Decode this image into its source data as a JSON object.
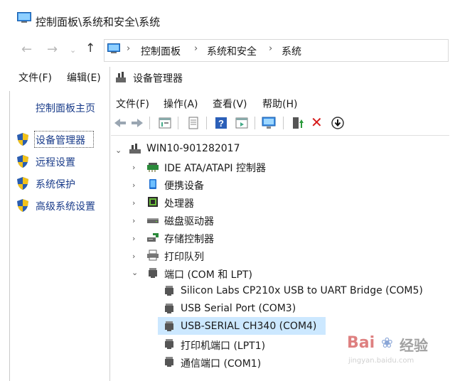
{
  "outer_window": {
    "title": "控制面板\\系统和安全\\系统",
    "breadcrumbs": [
      "控制面板",
      "系统和安全",
      "系统"
    ],
    "menu": [
      "文件(F)",
      "编辑(E)"
    ]
  },
  "left_pane": {
    "home": "控制面板主页",
    "items": [
      {
        "label": "设备管理器",
        "icon": "shield-icon"
      },
      {
        "label": "远程设置",
        "icon": "shield-icon"
      },
      {
        "label": "系统保护",
        "icon": "shield-icon"
      },
      {
        "label": "高级系统设置",
        "icon": "shield-icon"
      }
    ]
  },
  "device_manager": {
    "title": "设备管理器",
    "menu": [
      "文件(F)",
      "操作(A)",
      "查看(V)",
      "帮助(H)"
    ],
    "toolbar": [
      "back-icon",
      "forward-icon",
      "properties-icon",
      "print-icon",
      "help-icon",
      "view-icon",
      "monitor-icon",
      "update-driver-icon",
      "uninstall-icon",
      "download-icon"
    ],
    "root": "WIN10-901282017",
    "categories": [
      {
        "label": "IDE ATA/ATAPI 控制器",
        "expanded": false,
        "icon": "ide-controller-icon"
      },
      {
        "label": "便携设备",
        "expanded": false,
        "icon": "portable-device-icon"
      },
      {
        "label": "处理器",
        "expanded": false,
        "icon": "processor-icon"
      },
      {
        "label": "磁盘驱动器",
        "expanded": false,
        "icon": "disk-drive-icon"
      },
      {
        "label": "存储控制器",
        "expanded": false,
        "icon": "storage-controller-icon"
      },
      {
        "label": "打印队列",
        "expanded": false,
        "icon": "print-queue-icon"
      },
      {
        "label": "端口 (COM 和 LPT)",
        "expanded": true,
        "icon": "port-icon"
      }
    ],
    "ports": [
      {
        "label": "Silicon Labs CP210x USB to UART Bridge (COM5)",
        "selected": false
      },
      {
        "label": "USB Serial Port (COM3)",
        "selected": false
      },
      {
        "label": "USB-SERIAL CH340 (COM4)",
        "selected": true
      },
      {
        "label": "打印机端口 (LPT1)",
        "selected": false
      },
      {
        "label": "通信端口 (COM1)",
        "selected": false
      }
    ]
  },
  "watermark": {
    "brand": "Bai",
    "brand2": "经验",
    "url": "jingyan.baidu.com"
  }
}
